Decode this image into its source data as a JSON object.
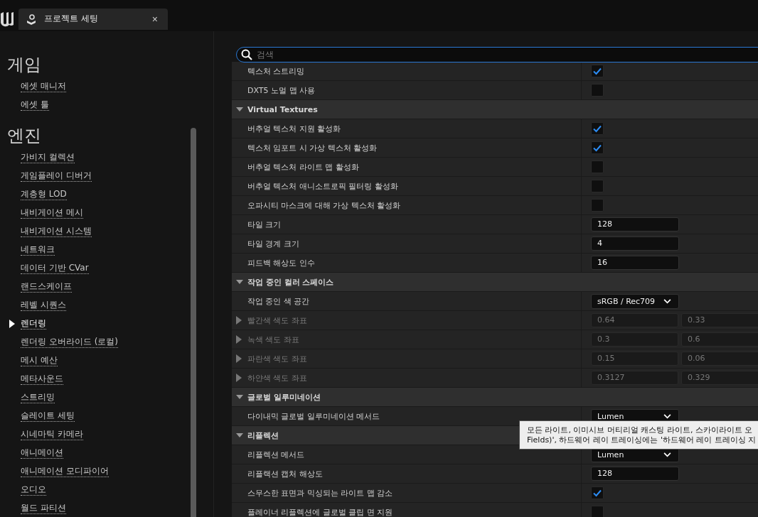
{
  "tab": {
    "title": "프로젝트 세팅",
    "close": "×"
  },
  "sidebar": [
    {
      "heading": "게임",
      "items": [
        {
          "label": "에셋 매니저",
          "selected": false
        },
        {
          "label": "에셋 툴",
          "selected": false
        }
      ]
    },
    {
      "heading": "엔진",
      "items": [
        {
          "label": "가비지 컬렉션",
          "selected": false
        },
        {
          "label": "게임플레이 디버거",
          "selected": false
        },
        {
          "label": "계층형 LOD",
          "selected": false
        },
        {
          "label": "내비게이션 메시",
          "selected": false
        },
        {
          "label": "내비게이션 시스템",
          "selected": false
        },
        {
          "label": "네트워크",
          "selected": false
        },
        {
          "label": "데이터 기반 CVar",
          "selected": false
        },
        {
          "label": "랜드스케이프",
          "selected": false
        },
        {
          "label": "레벨 시퀀스",
          "selected": false
        },
        {
          "label": "렌더링",
          "selected": true
        },
        {
          "label": "렌더링 오버라이드 (로컬)",
          "selected": false
        },
        {
          "label": "메시 예산",
          "selected": false
        },
        {
          "label": "메타사운드",
          "selected": false
        },
        {
          "label": "스트리밍",
          "selected": false
        },
        {
          "label": "슬레이트 세팅",
          "selected": false
        },
        {
          "label": "시네마틱 카메라",
          "selected": false
        },
        {
          "label": "애니메이션",
          "selected": false
        },
        {
          "label": "애니메이션 모디파이어",
          "selected": false
        },
        {
          "label": "오디오",
          "selected": false
        },
        {
          "label": "월드 파티션",
          "selected": false
        }
      ]
    }
  ],
  "search": {
    "placeholder": "검색"
  },
  "rows": [
    {
      "kind": "checkbox",
      "label": "텍스처 스트리밍",
      "checked": true
    },
    {
      "kind": "checkbox",
      "label": "DXT5 노멀 맵 사용",
      "checked": false
    },
    {
      "kind": "category",
      "label": "Virtual Textures",
      "expanded": true
    },
    {
      "kind": "checkbox",
      "label": "버추얼 텍스처 지원 활성화",
      "checked": true
    },
    {
      "kind": "checkbox",
      "label": "텍스처 임포트 시 가상 텍스처 활성화",
      "checked": true
    },
    {
      "kind": "checkbox",
      "label": "버추얼 텍스처 라이트 맵 활성화",
      "checked": false
    },
    {
      "kind": "checkbox",
      "label": "버추얼 텍스처 애니소트로픽 필터링 활성화",
      "checked": false
    },
    {
      "kind": "checkbox",
      "label": "오파시티 마스크에 대해 가상 텍스처 활성화",
      "checked": false
    },
    {
      "kind": "number",
      "label": "타일 크기",
      "value": "128"
    },
    {
      "kind": "number",
      "label": "타일 경계 크기",
      "value": "4"
    },
    {
      "kind": "number",
      "label": "피드백 해상도 인수",
      "value": "16"
    },
    {
      "kind": "category",
      "label": "작업 중인 컬러 스페이스",
      "expanded": true
    },
    {
      "kind": "dropdown",
      "label": "작업 중인 색 공간",
      "value": "sRGB / Rec709"
    },
    {
      "kind": "vector",
      "label": "빨간색 색도 좌표",
      "disabled": true,
      "values": [
        "0.64",
        "0.33"
      ]
    },
    {
      "kind": "vector",
      "label": "녹색 색도 좌표",
      "disabled": true,
      "values": [
        "0.3",
        "0.6"
      ]
    },
    {
      "kind": "vector",
      "label": "파란색 색도 좌표",
      "disabled": true,
      "values": [
        "0.15",
        "0.06"
      ]
    },
    {
      "kind": "vector",
      "label": "하얀색 색도 좌표",
      "disabled": true,
      "values": [
        "0.3127",
        "0.329"
      ]
    },
    {
      "kind": "category",
      "label": "글로벌 일루미네이션",
      "expanded": true
    },
    {
      "kind": "dropdown",
      "label": "다이내믹 글로벌 일루미네이션 메서드",
      "value": "Lumen"
    },
    {
      "kind": "category",
      "label": "리플렉션",
      "expanded": true
    },
    {
      "kind": "dropdown",
      "label": "리플렉션 메서드",
      "value": "Lumen"
    },
    {
      "kind": "number",
      "label": "리플랙션 캡처 해상도",
      "value": "128"
    },
    {
      "kind": "checkbox",
      "label": "스무스한 표면과 믹싱되는 라이트 맵 감소",
      "checked": true
    },
    {
      "kind": "checkbox",
      "label": "플레이너 리플렉션에 글로벌 클립 면 지원",
      "checked": false
    }
  ],
  "tooltip": {
    "lines": [
      "모든 라이트, 이미시브 머티리얼 캐스팅 라이트, 스카이라이트 오",
      "Fields)', 하드웨어 레이 트레이싱에는 '하드웨어 레이 트레이싱 지"
    ]
  }
}
